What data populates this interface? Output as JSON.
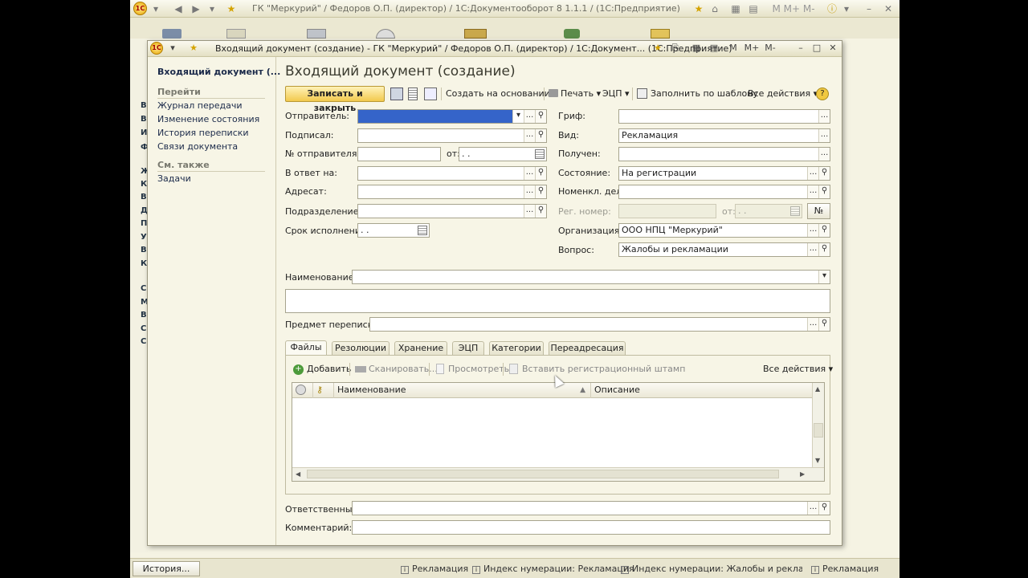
{
  "app": {
    "title": "ГК \"Меркурий\" / Федоров О.П. (директор) / 1С:Документооборот 8 1.1.1 / (1С:Предприятие)",
    "title_right": "M  M+  M-",
    "left_letters": [
      "В",
      "В",
      "И",
      "Ф",
      "Ж",
      "К",
      "В",
      "Д",
      "П",
      "У",
      "В",
      "К",
      "С",
      "М",
      "В",
      "С",
      "С"
    ],
    "statusbar": {
      "history_label": "История...",
      "items": [
        "Рекламация",
        "Индекс нумерации: Рекламация",
        "Индекс нумерации: Жалобы и рекламации",
        "Рекламация"
      ]
    }
  },
  "window": {
    "title": "Входящий документ (создание) - ГК \"Меркурий\" / Федоров О.П. (директор) / 1С:Документ...  (1С:Предприятие)",
    "mem_labels": [
      "M",
      "M+",
      "M-"
    ]
  },
  "sidebar": {
    "doc_title": "Входящий документ (...",
    "goto_header": "Перейти",
    "goto_items": [
      "Журнал передачи",
      "Изменение состояния",
      "История переписки",
      "Связи документа"
    ],
    "see_also_header": "См. также",
    "see_also_items": [
      "Задачи"
    ]
  },
  "form": {
    "heading": "Входящий документ (создание)",
    "toolbar": {
      "save_close": "Записать и закрыть",
      "create_based": "Создать на основании",
      "print": "Печать",
      "ecp": "ЭЦП",
      "fill_template": "Заполнить по шаблону",
      "all_actions": "Все действия",
      "help": "?"
    },
    "left_fields": {
      "sender": {
        "label": "Отправитель:",
        "value": ""
      },
      "signed": {
        "label": "Подписал:",
        "value": ""
      },
      "sender_no": {
        "label": "№ отправителя:",
        "value": ""
      },
      "sender_date": {
        "label": "от:",
        "value": " .  ."
      },
      "in_reply": {
        "label": "В ответ на:",
        "value": ""
      },
      "addressee": {
        "label": "Адресат:",
        "value": ""
      },
      "department": {
        "label": "Подразделение:",
        "value": ""
      },
      "deadline": {
        "label": "Срок исполнения:",
        "value": " .  ."
      }
    },
    "right_fields": {
      "stamp": {
        "label": "Гриф:",
        "value": ""
      },
      "kind": {
        "label": "Вид:",
        "value": "Рекламация"
      },
      "received": {
        "label": "Получен:",
        "value": ""
      },
      "state": {
        "label": "Состояние:",
        "value": "На регистрации"
      },
      "nomenclature": {
        "label": "Номенкл. дел:",
        "value": ""
      },
      "reg_no": {
        "label": "Рег. номер:",
        "value": ""
      },
      "reg_date": {
        "label": "от:",
        "value": " .  ."
      },
      "no_button": "№",
      "organization": {
        "label": "Организация:",
        "value": "ООО НПЦ \"Меркурий\""
      },
      "question": {
        "label": "Вопрос:",
        "value": "Жалобы и рекламации"
      }
    },
    "name": {
      "label": "Наименование:",
      "value": ""
    },
    "subject": {
      "label": "Предмет переписки:",
      "value": ""
    },
    "tabs": [
      "Файлы",
      "Резолюции",
      "Хранение",
      "ЭЦП",
      "Категории",
      "Переадресация"
    ],
    "files": {
      "add": "Добавить",
      "scan": "Сканировать...",
      "view": "Просмотреть",
      "stamp": "Вставить регистрационный штамп",
      "all_actions": "Все действия",
      "col_name": "Наименование",
      "col_desc": "Описание"
    },
    "responsible": {
      "label": "Ответственный:",
      "value": ""
    },
    "comment": {
      "label": "Комментарий:",
      "value": ""
    }
  },
  "colors": {
    "accent": "#f2c94d",
    "selection": "#3564c9",
    "background": "#f7f5e6"
  }
}
